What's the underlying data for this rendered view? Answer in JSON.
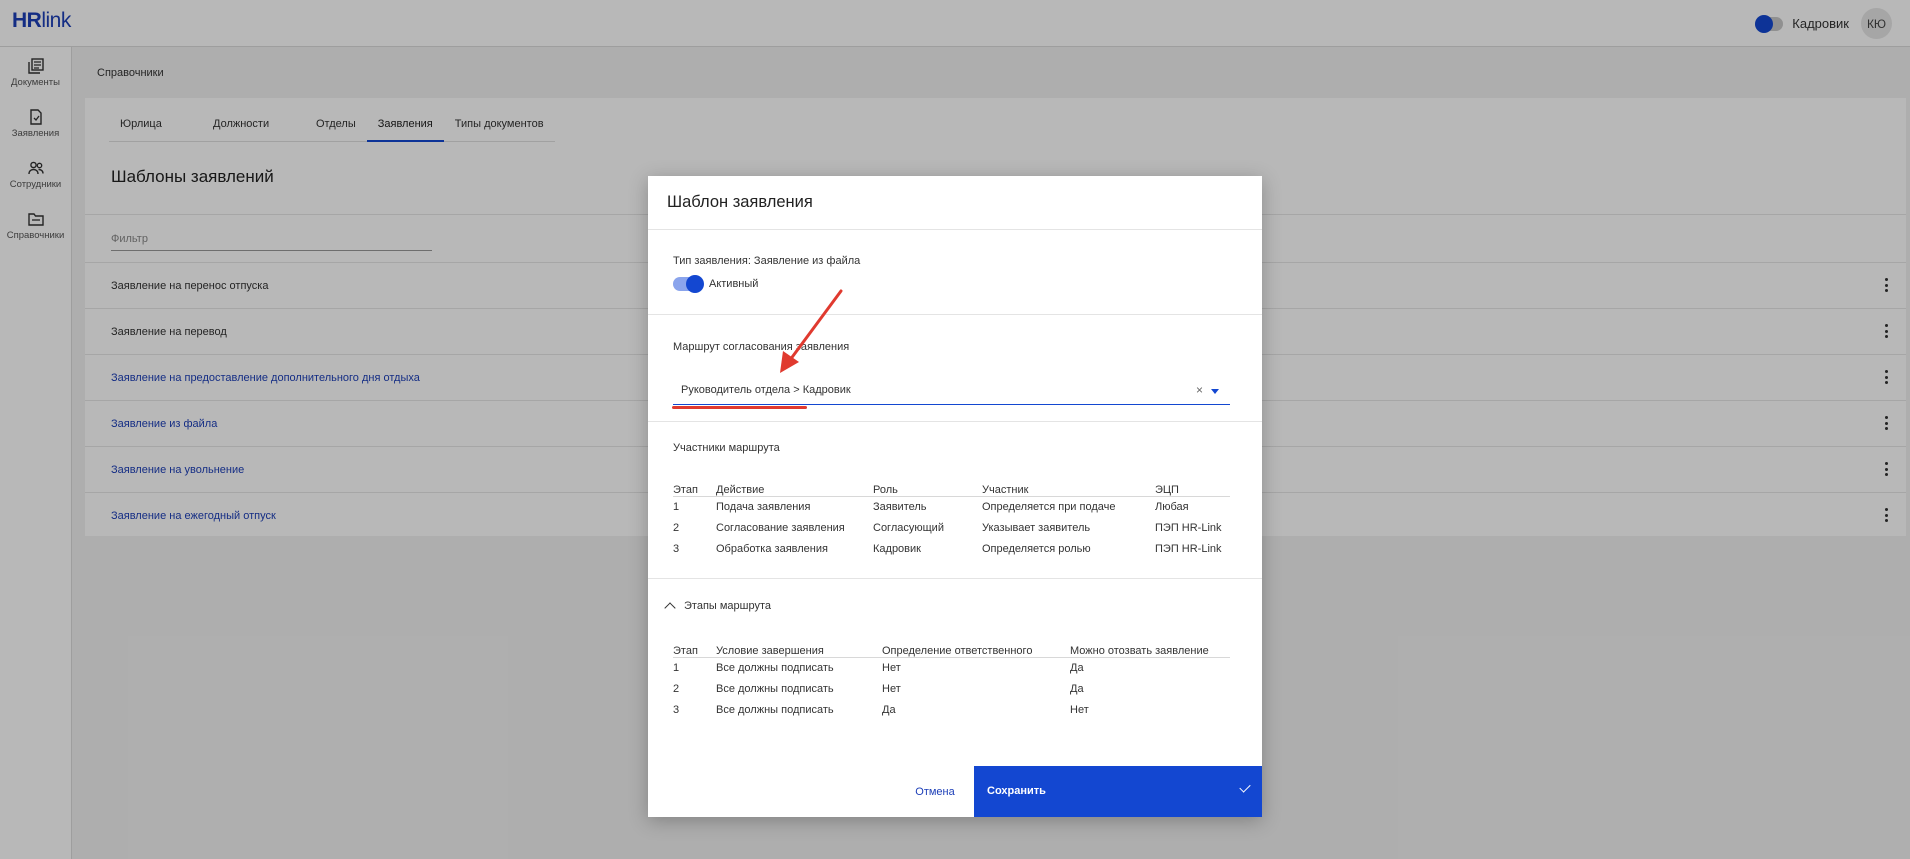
{
  "app": {
    "logo_hr": "HR",
    "logo_link": "link",
    "role": "Кадровик",
    "avatar_initials": "КЮ"
  },
  "sidebar": {
    "items": [
      {
        "icon": "documents-icon",
        "label": "Документы"
      },
      {
        "icon": "applications-icon",
        "label": "Заявления"
      },
      {
        "icon": "employees-icon",
        "label": "Сотрудники"
      },
      {
        "icon": "directories-icon",
        "label": "Справочники"
      }
    ]
  },
  "breadcrumb": "Справочники",
  "tabs": [
    "Юрлица",
    "Должности",
    "Отделы",
    "Заявления",
    "Типы документов"
  ],
  "active_tab": "Заявления",
  "page_title": "Шаблоны заявлений",
  "filter_placeholder": "Фильтр",
  "templates": [
    "Заявление на перенос отпуска",
    "Заявление на перевод",
    "Заявление на предоставление дополнительного дня отдыха",
    "Заявление из файла",
    "Заявление на увольнение",
    "Заявление на ежегодный отпуск"
  ],
  "modal": {
    "title": "Шаблон заявления",
    "type_label": "Тип заявления: Заявление из файла",
    "active_label": "Активный",
    "active": true,
    "route_label": "Маршрут согласования заявления",
    "route_value": "Руководитель отдела > Кадровик",
    "clear_symbol": "×",
    "participants_title": "Участники маршрута",
    "participants_headers": [
      "Этап",
      "Действие",
      "Роль",
      "Участник",
      "ЭЦП"
    ],
    "participants": [
      [
        "1",
        "Подача заявления",
        "Заявитель",
        "Определяется при подаче",
        "Любая"
      ],
      [
        "2",
        "Согласование заявления",
        "Согласующий",
        "Указывает заявитель",
        "ПЭП HR-Link"
      ],
      [
        "3",
        "Обработка заявления",
        "Кадровик",
        "Определяется ролью",
        "ПЭП HR-Link"
      ]
    ],
    "stages_title": "Этапы маршрута",
    "stages_headers": [
      "Этап",
      "Условие завершения",
      "Определение ответственного",
      "Можно отозвать заявление"
    ],
    "stages": [
      [
        "1",
        "Все должны подписать",
        "Нет",
        "Да"
      ],
      [
        "2",
        "Все должны подписать",
        "Нет",
        "Да"
      ],
      [
        "3",
        "Все должны подписать",
        "Да",
        "Нет"
      ]
    ],
    "cancel_label": "Отмена",
    "save_label": "Сохранить"
  },
  "colors": {
    "brand": "#1347d1",
    "annotation": "#e03a2f"
  }
}
